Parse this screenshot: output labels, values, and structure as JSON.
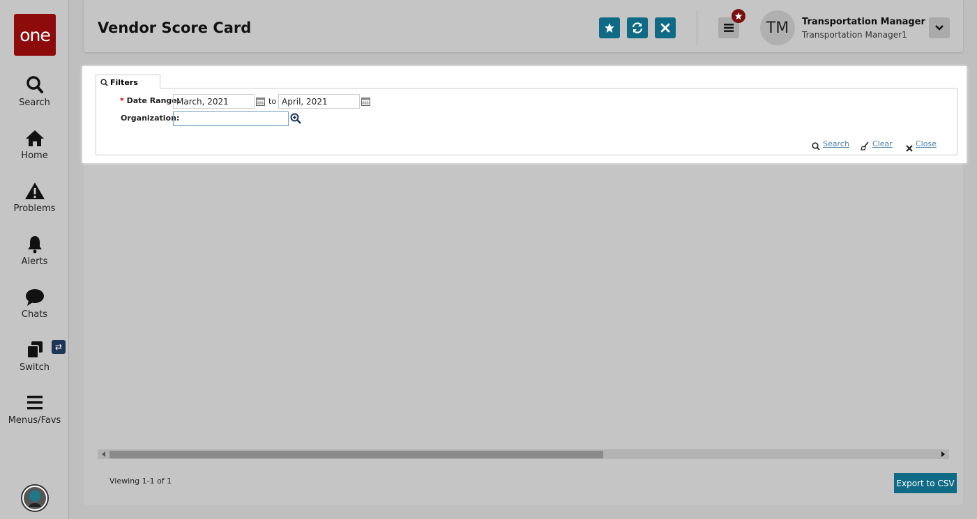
{
  "app": {
    "logo_text": "one",
    "brand_color": "#8e0b0b",
    "accent_color": "#0f6b85"
  },
  "sidebar": {
    "items": [
      {
        "label": "Search",
        "icon": "search-icon"
      },
      {
        "label": "Home",
        "icon": "home-icon"
      },
      {
        "label": "Problems",
        "icon": "warning-icon"
      },
      {
        "label": "Alerts",
        "icon": "bell-icon"
      },
      {
        "label": "Chats",
        "icon": "chat-icon"
      },
      {
        "label": "Switch",
        "icon": "switch-icon"
      },
      {
        "label": "Menus/Favs",
        "icon": "menu-icon"
      }
    ],
    "switch_badge": "⇄"
  },
  "header": {
    "title": "Vendor Score Card",
    "user_initials": "TM",
    "user_name": "Transportation Manager",
    "user_role": "Transportation Manager1"
  },
  "filters": {
    "tab_label": "Filters",
    "date_range_label": "Date Range:",
    "required_mark": "*",
    "date_from": "March, 2021",
    "to_label": "to",
    "date_to": "April, 2021",
    "organization_label": "Organization:",
    "organization_value": "",
    "search_link": "Search",
    "clear_link": "Clear",
    "close_link": "Close"
  },
  "footer": {
    "viewing": "Viewing 1-1 of 1",
    "export_button": "Export to CSV"
  }
}
